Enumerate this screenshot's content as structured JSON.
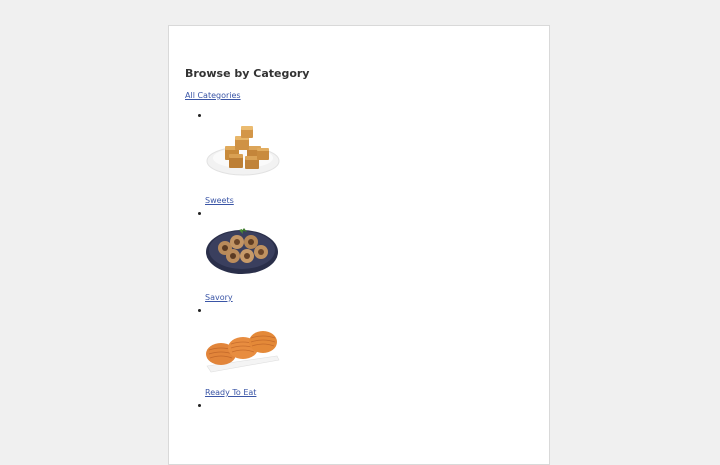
{
  "section": {
    "title": "Browse by Category",
    "all_link": "All Categories"
  },
  "categories": [
    {
      "label": "Sweets",
      "icon": "sweets-icon"
    },
    {
      "label": "Savory",
      "icon": "savory-icon"
    },
    {
      "label": "Ready To Eat",
      "icon": "ready-to-eat-icon"
    },
    {
      "label": "",
      "icon": ""
    }
  ]
}
